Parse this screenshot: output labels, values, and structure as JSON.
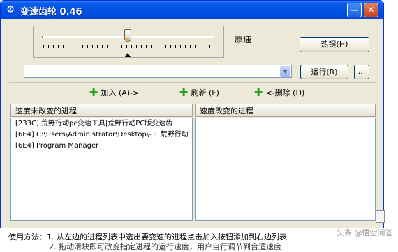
{
  "window": {
    "title": "变速齿轮 0.46",
    "icon": "gear-icon",
    "min_glyph": "—",
    "close_glyph": "✕"
  },
  "slider": {
    "label": "原速",
    "value": 0.5
  },
  "buttons": {
    "hotkey": "热键(H)",
    "run": "运行(R)",
    "more": "..."
  },
  "process_combo": {
    "value": "",
    "arrow": "▼"
  },
  "actions": {
    "add": {
      "icon": "green-plus-icon",
      "glyph": "✚",
      "label": "加入 (A)->"
    },
    "refresh": {
      "icon": "green-plus-icon",
      "glyph": "✚",
      "label": "刷新 (F)"
    },
    "remove": {
      "icon": "green-plus-icon",
      "glyph": "✚",
      "label": "<-删除 (D)"
    }
  },
  "lists": {
    "unchanged_header": "速度未改变的进程",
    "changed_header": "速度改变的进程",
    "unchanged_items": [
      "[233C] 荒野行动pc变速工具|荒野行动PC版变速齿",
      "[6E4] C:\\Users\\Administrator\\Desktop\\- 1 荒野行动",
      "[6E4] Program Manager"
    ]
  },
  "footer": {
    "line1": "使用方法：1. 从左边的进程列表中选出要变速的进程点击加入按钮添加到右边列表",
    "line2": "2. 拖动滑块即可改变指定进程的运行速度，用户自行调节到合适速度"
  },
  "watermark": "头条 @悟空问答"
}
